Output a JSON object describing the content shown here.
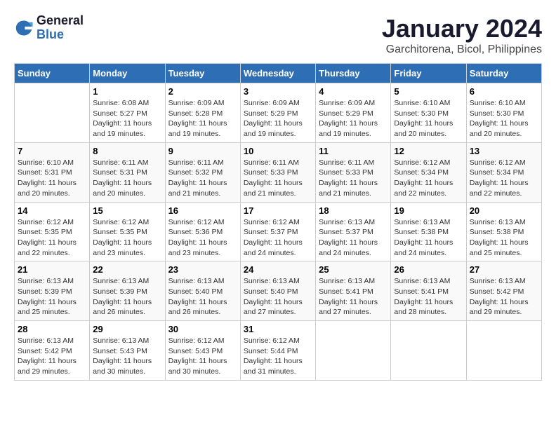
{
  "header": {
    "logo_line1": "General",
    "logo_line2": "Blue",
    "month": "January 2024",
    "location": "Garchitorena, Bicol, Philippines"
  },
  "days_of_week": [
    "Sunday",
    "Monday",
    "Tuesday",
    "Wednesday",
    "Thursday",
    "Friday",
    "Saturday"
  ],
  "weeks": [
    [
      {
        "day": "",
        "info": ""
      },
      {
        "day": "1",
        "info": "Sunrise: 6:08 AM\nSunset: 5:27 PM\nDaylight: 11 hours\nand 19 minutes."
      },
      {
        "day": "2",
        "info": "Sunrise: 6:09 AM\nSunset: 5:28 PM\nDaylight: 11 hours\nand 19 minutes."
      },
      {
        "day": "3",
        "info": "Sunrise: 6:09 AM\nSunset: 5:29 PM\nDaylight: 11 hours\nand 19 minutes."
      },
      {
        "day": "4",
        "info": "Sunrise: 6:09 AM\nSunset: 5:29 PM\nDaylight: 11 hours\nand 19 minutes."
      },
      {
        "day": "5",
        "info": "Sunrise: 6:10 AM\nSunset: 5:30 PM\nDaylight: 11 hours\nand 20 minutes."
      },
      {
        "day": "6",
        "info": "Sunrise: 6:10 AM\nSunset: 5:30 PM\nDaylight: 11 hours\nand 20 minutes."
      }
    ],
    [
      {
        "day": "7",
        "info": "Sunrise: 6:10 AM\nSunset: 5:31 PM\nDaylight: 11 hours\nand 20 minutes."
      },
      {
        "day": "8",
        "info": "Sunrise: 6:11 AM\nSunset: 5:31 PM\nDaylight: 11 hours\nand 20 minutes."
      },
      {
        "day": "9",
        "info": "Sunrise: 6:11 AM\nSunset: 5:32 PM\nDaylight: 11 hours\nand 21 minutes."
      },
      {
        "day": "10",
        "info": "Sunrise: 6:11 AM\nSunset: 5:33 PM\nDaylight: 11 hours\nand 21 minutes."
      },
      {
        "day": "11",
        "info": "Sunrise: 6:11 AM\nSunset: 5:33 PM\nDaylight: 11 hours\nand 21 minutes."
      },
      {
        "day": "12",
        "info": "Sunrise: 6:12 AM\nSunset: 5:34 PM\nDaylight: 11 hours\nand 22 minutes."
      },
      {
        "day": "13",
        "info": "Sunrise: 6:12 AM\nSunset: 5:34 PM\nDaylight: 11 hours\nand 22 minutes."
      }
    ],
    [
      {
        "day": "14",
        "info": "Sunrise: 6:12 AM\nSunset: 5:35 PM\nDaylight: 11 hours\nand 22 minutes."
      },
      {
        "day": "15",
        "info": "Sunrise: 6:12 AM\nSunset: 5:35 PM\nDaylight: 11 hours\nand 23 minutes."
      },
      {
        "day": "16",
        "info": "Sunrise: 6:12 AM\nSunset: 5:36 PM\nDaylight: 11 hours\nand 23 minutes."
      },
      {
        "day": "17",
        "info": "Sunrise: 6:12 AM\nSunset: 5:37 PM\nDaylight: 11 hours\nand 24 minutes."
      },
      {
        "day": "18",
        "info": "Sunrise: 6:13 AM\nSunset: 5:37 PM\nDaylight: 11 hours\nand 24 minutes."
      },
      {
        "day": "19",
        "info": "Sunrise: 6:13 AM\nSunset: 5:38 PM\nDaylight: 11 hours\nand 24 minutes."
      },
      {
        "day": "20",
        "info": "Sunrise: 6:13 AM\nSunset: 5:38 PM\nDaylight: 11 hours\nand 25 minutes."
      }
    ],
    [
      {
        "day": "21",
        "info": "Sunrise: 6:13 AM\nSunset: 5:39 PM\nDaylight: 11 hours\nand 25 minutes."
      },
      {
        "day": "22",
        "info": "Sunrise: 6:13 AM\nSunset: 5:39 PM\nDaylight: 11 hours\nand 26 minutes."
      },
      {
        "day": "23",
        "info": "Sunrise: 6:13 AM\nSunset: 5:40 PM\nDaylight: 11 hours\nand 26 minutes."
      },
      {
        "day": "24",
        "info": "Sunrise: 6:13 AM\nSunset: 5:40 PM\nDaylight: 11 hours\nand 27 minutes."
      },
      {
        "day": "25",
        "info": "Sunrise: 6:13 AM\nSunset: 5:41 PM\nDaylight: 11 hours\nand 27 minutes."
      },
      {
        "day": "26",
        "info": "Sunrise: 6:13 AM\nSunset: 5:41 PM\nDaylight: 11 hours\nand 28 minutes."
      },
      {
        "day": "27",
        "info": "Sunrise: 6:13 AM\nSunset: 5:42 PM\nDaylight: 11 hours\nand 29 minutes."
      }
    ],
    [
      {
        "day": "28",
        "info": "Sunrise: 6:13 AM\nSunset: 5:42 PM\nDaylight: 11 hours\nand 29 minutes."
      },
      {
        "day": "29",
        "info": "Sunrise: 6:13 AM\nSunset: 5:43 PM\nDaylight: 11 hours\nand 30 minutes."
      },
      {
        "day": "30",
        "info": "Sunrise: 6:12 AM\nSunset: 5:43 PM\nDaylight: 11 hours\nand 30 minutes."
      },
      {
        "day": "31",
        "info": "Sunrise: 6:12 AM\nSunset: 5:44 PM\nDaylight: 11 hours\nand 31 minutes."
      },
      {
        "day": "",
        "info": ""
      },
      {
        "day": "",
        "info": ""
      },
      {
        "day": "",
        "info": ""
      }
    ]
  ]
}
